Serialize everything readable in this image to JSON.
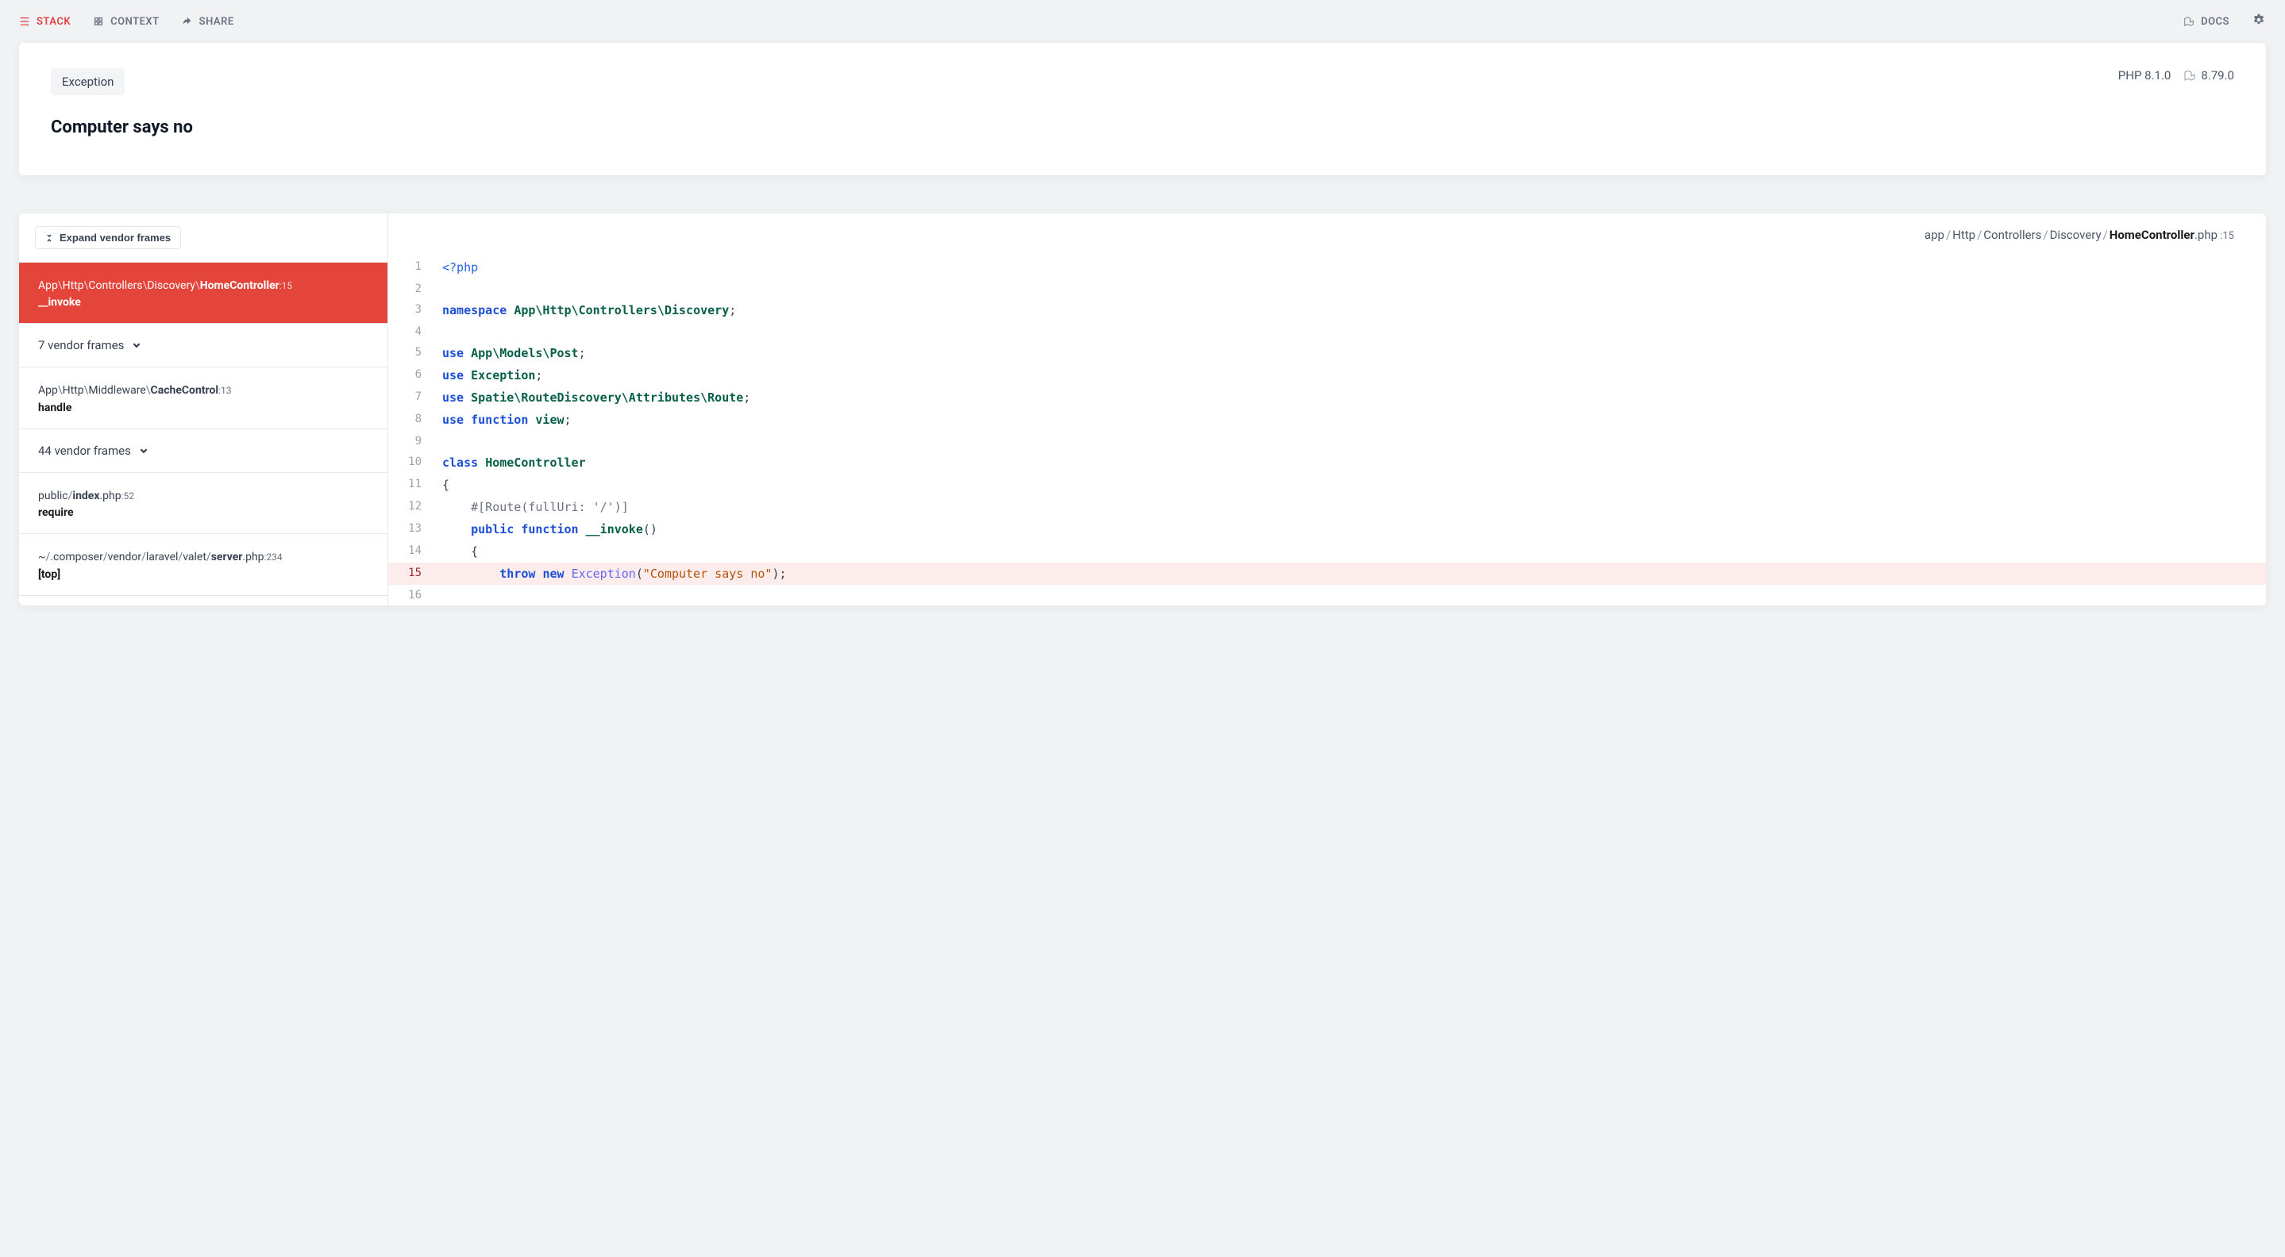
{
  "nav": {
    "stack": "STACK",
    "context": "CONTEXT",
    "share": "SHARE",
    "docs": "DOCS"
  },
  "hero": {
    "exception_class": "Exception",
    "title": "Computer says no",
    "php_version": "PHP 8.1.0",
    "laravel_version": "8.79.0"
  },
  "sidebar": {
    "expand_label": "Expand vendor frames",
    "frames": [
      {
        "kind": "frame",
        "active": true,
        "segments": [
          "App",
          "Http",
          "Controllers",
          "Discovery",
          "HomeController"
        ],
        "sep": "\\",
        "line": "15",
        "method": "__invoke"
      },
      {
        "kind": "collapsed",
        "label": "7 vendor frames"
      },
      {
        "kind": "frame",
        "active": false,
        "segments": [
          "App",
          "Http",
          "Middleware",
          "CacheControl"
        ],
        "sep": "\\",
        "line": "13",
        "method": "handle"
      },
      {
        "kind": "collapsed",
        "label": "44 vendor frames"
      },
      {
        "kind": "frame",
        "active": false,
        "segments": [
          "public",
          "index"
        ],
        "sep": "/",
        "ext": ".php",
        "line": "52",
        "method": "require"
      },
      {
        "kind": "frame",
        "active": false,
        "segments": [
          "~",
          ".composer",
          "vendor",
          "laravel",
          "valet",
          "server"
        ],
        "sep": "/",
        "ext": ".php",
        "line": "234",
        "method": "[top]"
      }
    ]
  },
  "code": {
    "breadcrumb": {
      "segments": [
        "app",
        "Http",
        "Controllers",
        "Discovery"
      ],
      "file": "HomeController",
      "ext": ".php",
      "line": "15"
    },
    "lines": [
      {
        "n": 1,
        "hl": false,
        "tokens": [
          {
            "t": "<?php",
            "c": "tk-tag"
          }
        ]
      },
      {
        "n": 2,
        "hl": false,
        "tokens": []
      },
      {
        "n": 3,
        "hl": false,
        "tokens": [
          {
            "t": "namespace ",
            "c": "tk-kw"
          },
          {
            "t": "App\\Http\\Controllers\\Discovery",
            "c": "tk-ns"
          },
          {
            "t": ";",
            "c": "tk-pl"
          }
        ]
      },
      {
        "n": 4,
        "hl": false,
        "tokens": []
      },
      {
        "n": 5,
        "hl": false,
        "tokens": [
          {
            "t": "use ",
            "c": "tk-kw"
          },
          {
            "t": "App\\Models\\Post",
            "c": "tk-ns"
          },
          {
            "t": ";",
            "c": "tk-pl"
          }
        ]
      },
      {
        "n": 6,
        "hl": false,
        "tokens": [
          {
            "t": "use ",
            "c": "tk-kw"
          },
          {
            "t": "Exception",
            "c": "tk-ns"
          },
          {
            "t": ";",
            "c": "tk-pl"
          }
        ]
      },
      {
        "n": 7,
        "hl": false,
        "tokens": [
          {
            "t": "use ",
            "c": "tk-kw"
          },
          {
            "t": "Spatie\\RouteDiscovery\\Attributes\\Route",
            "c": "tk-ns"
          },
          {
            "t": ";",
            "c": "tk-pl"
          }
        ]
      },
      {
        "n": 8,
        "hl": false,
        "tokens": [
          {
            "t": "use ",
            "c": "tk-kw"
          },
          {
            "t": "function ",
            "c": "tk-kw"
          },
          {
            "t": "view",
            "c": "tk-ns"
          },
          {
            "t": ";",
            "c": "tk-pl"
          }
        ]
      },
      {
        "n": 9,
        "hl": false,
        "tokens": []
      },
      {
        "n": 10,
        "hl": false,
        "tokens": [
          {
            "t": "class ",
            "c": "tk-kw"
          },
          {
            "t": "HomeController",
            "c": "tk-ns"
          }
        ]
      },
      {
        "n": 11,
        "hl": false,
        "tokens": [
          {
            "t": "{",
            "c": "tk-pl"
          }
        ]
      },
      {
        "n": 12,
        "hl": false,
        "tokens": [
          {
            "t": "    #[Route(fullUri: '/')]",
            "c": "tk-cmt"
          }
        ]
      },
      {
        "n": 13,
        "hl": false,
        "tokens": [
          {
            "t": "    ",
            "c": ""
          },
          {
            "t": "public ",
            "c": "tk-kw"
          },
          {
            "t": "function ",
            "c": "tk-kw"
          },
          {
            "t": "__invoke",
            "c": "tk-fn"
          },
          {
            "t": "()",
            "c": "tk-pl"
          }
        ]
      },
      {
        "n": 14,
        "hl": false,
        "tokens": [
          {
            "t": "    {",
            "c": "tk-pl"
          }
        ]
      },
      {
        "n": 15,
        "hl": true,
        "tokens": [
          {
            "t": "        ",
            "c": ""
          },
          {
            "t": "throw ",
            "c": "tk-kw"
          },
          {
            "t": "new ",
            "c": "tk-kw"
          },
          {
            "t": "Exception",
            "c": "tk-cls"
          },
          {
            "t": "(",
            "c": "tk-pl"
          },
          {
            "t": "\"Computer says no\"",
            "c": "tk-str"
          },
          {
            "t": ");",
            "c": "tk-pl"
          }
        ]
      },
      {
        "n": 16,
        "hl": false,
        "tokens": []
      }
    ]
  }
}
